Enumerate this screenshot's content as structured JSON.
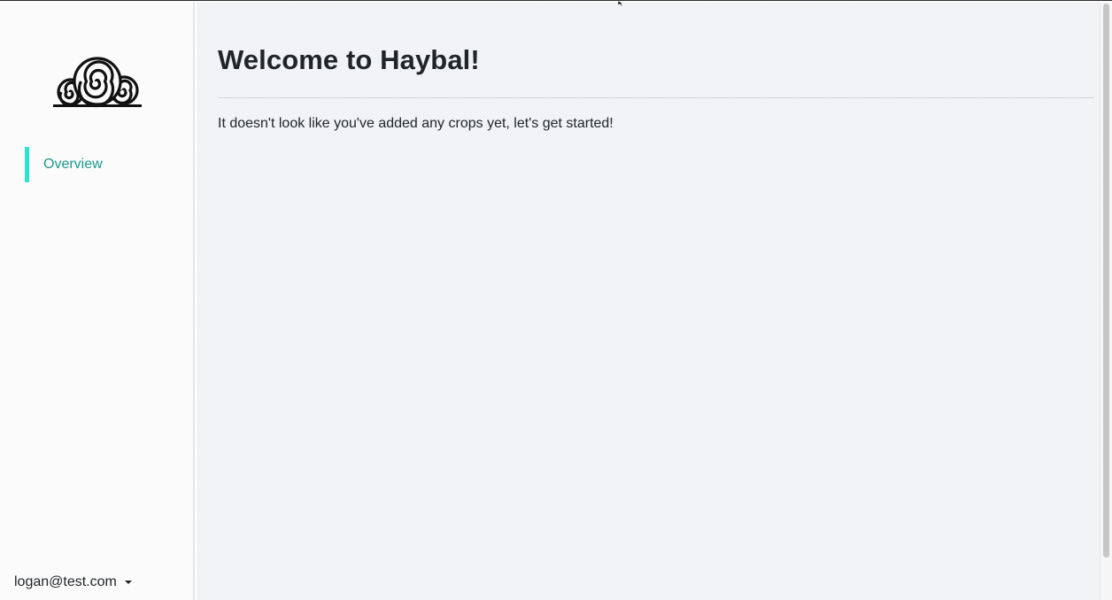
{
  "app": {
    "logo_icon": "hay-bales-logo-icon"
  },
  "sidebar": {
    "items": [
      {
        "label": "Overview",
        "active": true
      }
    ],
    "user_menu": {
      "email": "logan@test.com",
      "icon": "caret-down-icon"
    }
  },
  "main": {
    "title": "Welcome to Haybal!",
    "intro": "It doesn't look like you've added any crops yet, let's get started!"
  },
  "colors": {
    "accent_bar": "#2de1d3",
    "nav_active_text": "#1c9a8c",
    "text": "#212529",
    "main_background": "#eef0f3",
    "sidebar_background": "#fbfbfb"
  }
}
